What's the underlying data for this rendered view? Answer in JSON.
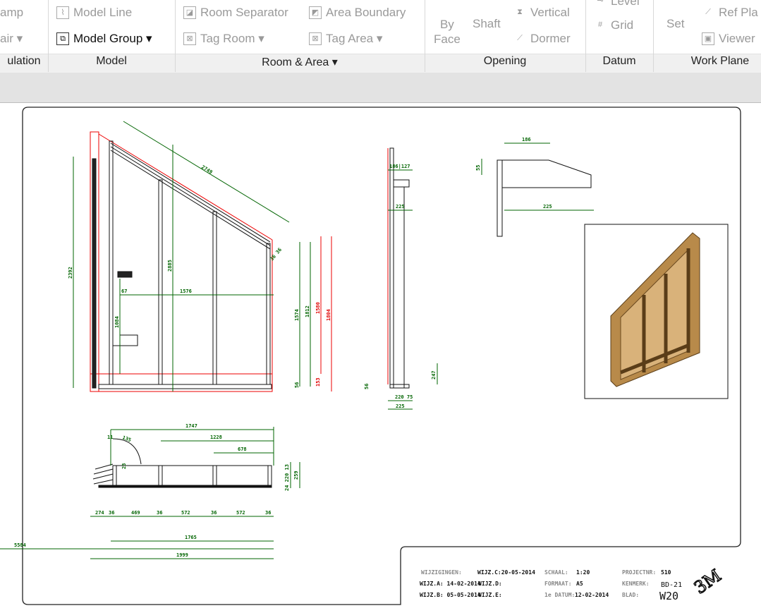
{
  "ribbon": {
    "circulation": {
      "ramp": "amp",
      "stair": "air ▾",
      "label": "ulation"
    },
    "model": {
      "model_line": "Model Line",
      "model_group": "Model Group ▾",
      "label": "Model"
    },
    "room_area": {
      "room_separator": "Room Separator",
      "area_boundary": "Area Boundary",
      "tag_room": "Tag Room ▾",
      "tag_area": "Tag Area ▾",
      "label": "Room & Area ▾"
    },
    "opening": {
      "by": "By",
      "face": "Face",
      "shaft": "Shaft",
      "vertical": "Vertical",
      "dormer": "Dormer",
      "label": "Opening"
    },
    "datum": {
      "level": "Level",
      "grid": "Grid",
      "label": "Datum"
    },
    "work_plane": {
      "set": "Set",
      "ref_plane": "Ref Pla",
      "viewer": "Viewer",
      "label": "Work Plane"
    }
  },
  "drawing": {
    "elevation": {
      "d2392": "2392",
      "d2885": "2885",
      "d2749": "2749",
      "d1576": "1576",
      "d1574": "1574",
      "d1812": "1812",
      "d1580": "1580",
      "d1804": "1804",
      "d56": "56",
      "d153": "153",
      "d1084": "1084",
      "d67": "67",
      "d36": "36 36"
    },
    "section": {
      "d186_127": "186|127",
      "d225": "225",
      "d247": "247",
      "d220_75": "220 75",
      "d225b": "225",
      "d56": "56"
    },
    "detail": {
      "d186": "186",
      "d55": "55",
      "d225": "225"
    },
    "plan": {
      "d1747": "1747",
      "d1228": "1228",
      "d678": "678",
      "d11": "11",
      "d135": "135",
      "d23": "23",
      "row": [
        "274",
        "36",
        "469",
        "36",
        "572",
        "36",
        "572",
        "36"
      ],
      "d1765": "1765",
      "d5584": "5584",
      "d1999": "1999",
      "side": "24 220 13",
      "d259": "259"
    }
  },
  "title_block": {
    "wijzigingen": "WIJZIGINGEN:",
    "wijc": "WIJZ.C:20-05-2014",
    "wija": "WIJZ.A: 14-02-2014",
    "wijd": "WIJZ.D:",
    "wijb": "WIJZ.B: 05-05-2014",
    "wije": "WIJZ.E:",
    "schaal_label": "SCHAAL:",
    "schaal": "1:20",
    "formaat_label": "FORMAAT:",
    "formaat": "A5",
    "datum_label": "1e DATUM:",
    "datum": "12-02-2014",
    "projectnr_label": "PROJECTNR:",
    "projectnr": "510",
    "kenmerk_label": "KENMERK:",
    "kenmerk": "BD-21",
    "blad_label": "BLAD:",
    "blad": "W20",
    "logo": "3M"
  }
}
